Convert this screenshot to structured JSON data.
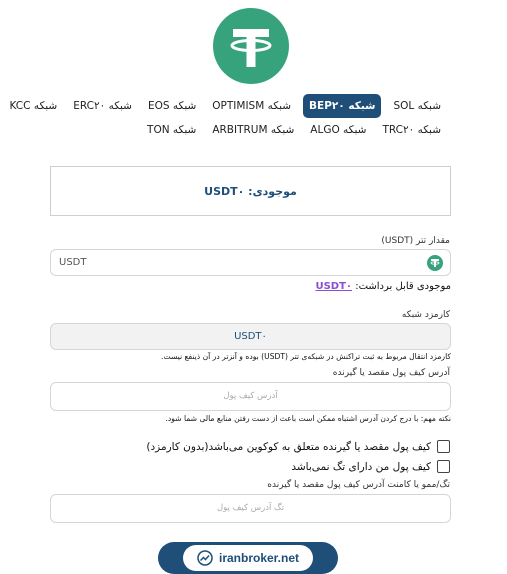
{
  "colors": {
    "accent": "#1f4e79",
    "tether": "#36a37c",
    "link": "#8a4fd1"
  },
  "networks_row1": [
    {
      "label": "شبکه SOL",
      "active": false
    },
    {
      "label": "شبکه BEP۲۰",
      "active": true
    },
    {
      "label": "شبکه OPTIMISM",
      "active": false
    },
    {
      "label": "شبکه EOS",
      "active": false
    },
    {
      "label": "شبکه ERC۲۰",
      "active": false
    },
    {
      "label": "شبکه KCC",
      "active": false
    }
  ],
  "networks_row2": [
    {
      "label": "شبکه TRC۲۰",
      "active": false
    },
    {
      "label": "شبکه ALGO",
      "active": false
    },
    {
      "label": "شبکه ARBITRUM",
      "active": false
    },
    {
      "label": "شبکه TON",
      "active": false
    }
  ],
  "balance": {
    "text": "موجودی: USDT۰"
  },
  "amount": {
    "label": "مقدار تتر (USDT)",
    "unit": "USDT"
  },
  "withdrawable": {
    "label": "موجودی قابل برداشت:",
    "value": "USDT۰"
  },
  "fee": {
    "label": "کارمزد شبکه",
    "value": "USDT۰",
    "note": "کارمزد انتقال مربوط به ثبت تراکنش در شبکه‌ی تتر (USDT) بوده و آنزتر در آن ذینفع نیست."
  },
  "address": {
    "label": "آدرس کیف پول مقصد یا گیرنده",
    "placeholder": "آدرس کیف پول",
    "note": "نکته مهم: با درج کردن آدرس اشتباه ممکن است باعث از دست رفتن منابع مالی شما شود."
  },
  "checkboxes": [
    {
      "label": "کیف پول مقصد یا گیرنده متعلق به کوکوین می‌باشد(بدون کارمزد)",
      "checked": false
    },
    {
      "label": "کیف پول من دارای تگ نمی‌باشد",
      "checked": false
    }
  ],
  "memo": {
    "label": "تگ/ممو یا کامنت آدرس کیف پول مقصد یا گیرنده",
    "placeholder": "تگ آدرس کیف پول"
  },
  "brand": {
    "text": "iranbroker.net"
  }
}
